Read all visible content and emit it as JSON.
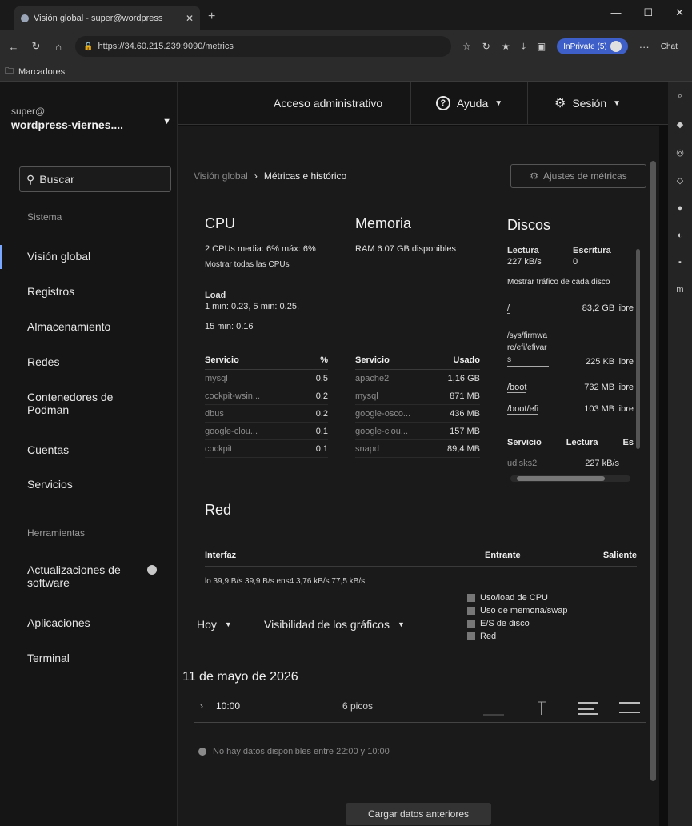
{
  "browser": {
    "tab_title": "Visión global - super@wordpress",
    "url": "https://34.60.215.239:9090/metrics",
    "inprivate_label": "InPrivate (5)",
    "chat_label": "Chat",
    "bookmarks_label": "Marcadores"
  },
  "host": {
    "user": "super@",
    "name": "wordpress-viernes...."
  },
  "search": {
    "placeholder": "Buscar"
  },
  "nav": {
    "section_system": "Sistema",
    "items_system": [
      "Visión global",
      "Registros",
      "Almacenamiento",
      "Redes",
      "Contenedores de Podman",
      "Cuentas",
      "Servicios"
    ],
    "section_tools": "Herramientas",
    "items_tools": [
      "Actualizaciones de software",
      "Aplicaciones",
      "Terminal"
    ]
  },
  "header": {
    "admin": "Acceso administrativo",
    "help": "Ayuda",
    "session": "Sesión"
  },
  "breadcrumb": {
    "parent": "Visión global",
    "current": "Métricas e histórico"
  },
  "settings_button": "Ajustes de métricas",
  "cpu": {
    "title": "CPU",
    "summary": "2 CPUs media: 6% máx: 6%",
    "show_all": "Mostrar todas las CPUs",
    "load_label": "Load",
    "load_line1": "1 min: 0.23, 5 min: 0.25,",
    "load_line2": "15 min: 0.16",
    "col_service": "Servicio",
    "col_pct": "%",
    "services": [
      {
        "name": "mysql",
        "value": "0.5"
      },
      {
        "name": "cockpit-wsin...",
        "value": "0.2"
      },
      {
        "name": "dbus",
        "value": "0.2"
      },
      {
        "name": "google-clou...",
        "value": "0.1"
      },
      {
        "name": "cockpit",
        "value": "0.1"
      }
    ]
  },
  "memory": {
    "title": "Memoria",
    "ram": "RAM  6.07 GB disponibles",
    "col_service": "Servicio",
    "col_used": "Usado",
    "services": [
      {
        "name": "apache2",
        "value": "1,16 GB"
      },
      {
        "name": "mysql",
        "value": "871 MB"
      },
      {
        "name": "google-osco...",
        "value": "436 MB"
      },
      {
        "name": "google-clou...",
        "value": "157 MB"
      },
      {
        "name": "snapd",
        "value": "89,4 MB"
      }
    ]
  },
  "disks": {
    "title": "Discos",
    "read_label": "Lectura",
    "write_label": "Escritura",
    "read_value": "227 kB/s",
    "write_value": "0",
    "show_traffic": "Mostrar tráfico de cada disco",
    "mounts": [
      {
        "path": "/",
        "free": "83,2 GB libre"
      },
      {
        "path": "/sys/firmwa re/efi/efivar s",
        "free": "225 KB libre"
      },
      {
        "path": "/boot",
        "free": "732 MB libre"
      },
      {
        "path": "/boot/efi",
        "free": "103 MB libre"
      }
    ],
    "col_service": "Servicio",
    "col_read": "Lectura",
    "col_write": "Es",
    "services": [
      {
        "name": "udisks2",
        "value": "227 kB/s"
      }
    ]
  },
  "network": {
    "title": "Red",
    "col_iface": "Interfaz",
    "col_in": "Entrante",
    "col_out": "Saliente",
    "row": "lo   39,9 B/s   39,9 B/s        ens4   3,76 kB/s   77,5 kB/s"
  },
  "legend": [
    "Uso/load de CPU",
    "Uso de memoria/swap",
    "E/S de disco",
    "Red"
  ],
  "controls": {
    "range": "Hoy",
    "visibility": "Visibilidad de los gráficos"
  },
  "history": {
    "date": "11 de mayo de 2026",
    "time": "10:00",
    "peaks": "6 picos",
    "no_data": "No hay datos disponibles entre 22:00 y 10:00"
  },
  "load_button": "Cargar datos anteriores"
}
